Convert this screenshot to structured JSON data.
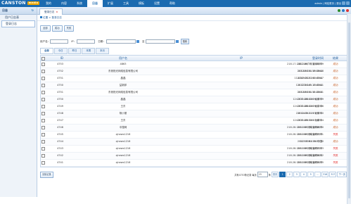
{
  "app": {
    "logo_text": "CANSTON",
    "logo_badge": "media",
    "top_nav": [
      "我的",
      "内容",
      "系统",
      "日志",
      "扩展",
      "工具",
      "模板",
      "设置",
      "帮助"
    ],
    "active_nav_index": 3,
    "user_info": "admin | 网站首页 | 退出"
  },
  "sidebar": {
    "title": "日志",
    "items": [
      {
        "label": "用户日志表",
        "selected": false
      },
      {
        "label": "登录日志",
        "selected": true
      }
    ]
  },
  "tab": {
    "label": "登录日志"
  },
  "breadcrumb": "位置 > 登录日志",
  "toolbar": {
    "buttons": [
      "全部",
      "成功",
      "失败"
    ]
  },
  "filter": {
    "user_label": "用户名：",
    "ip_label": "IP：",
    "date_label": "日期：",
    "to_label": "至",
    "search_label": "搜索"
  },
  "subtabs": [
    "全部",
    "今日",
    "昨日",
    "本周",
    "本月"
  ],
  "active_subtab": 0,
  "table": {
    "headers": {
      "id": "ID",
      "user": "用户名",
      "ip": "IP",
      "time": "登录时间",
      "result": "结果"
    },
    "rows": [
      {
        "id": "4753",
        "user": "4863",
        "ip": "218.17.148.216 广东省深圳市",
        "time": "2012-06-01 15:15:59",
        "result": "成功"
      },
      {
        "id": "4752",
        "user": "东莞阳光网络信息有限公司",
        "ip": "113.83.254.58 IANA",
        "time": "2012-06-01 15:15:08",
        "result": "成功"
      },
      {
        "id": "4751",
        "user": "晶晶",
        "ip": "114.249.212.160 IANA",
        "time": "2012-06-01 14:47:07",
        "result": "成功"
      },
      {
        "id": "4750",
        "user": "益新邦",
        "ip": "110.172.249.18 IANA",
        "time": "2012-06-01 13:47:01",
        "result": "成功"
      },
      {
        "id": "4751",
        "user": "东莞阳光网络信息有限公司",
        "ip": "113.83.254.58 IANA",
        "time": "2012-06-01 11:23:31",
        "result": "成功"
      },
      {
        "id": "4750",
        "user": "晶晶",
        "ip": "124.205.186.160 北京市",
        "time": "2012-06-01 09:28:59",
        "result": "成功"
      },
      {
        "id": "4749",
        "user": "王东",
        "ip": "124.205.186.160 北京市",
        "time": "2012-06-01 09:02:46",
        "result": "成功"
      },
      {
        "id": "4748",
        "user": "杨小丽",
        "ip": "210.14.142.19 北京市",
        "time": "2012-05-31 23:36:10",
        "result": "成功"
      },
      {
        "id": "4747",
        "user": "王东",
        "ip": "124.205.186.160 北京市",
        "time": "2012-05-31 17:48:24",
        "result": "成功"
      },
      {
        "id": "4746",
        "user": "中搜网",
        "ip": "218.28.115.130 河南省郑州市",
        "time": "2012-05-31 16:48:30",
        "result": "成功"
      },
      {
        "id": "4745",
        "user": "zjnews1216",
        "ip": "218.28.115.130 河南省郑州市",
        "time": "2012-05-31 16:37:31",
        "result": "失败"
      },
      {
        "id": "4744",
        "user": "zjnews1216",
        "ip": "117.136.0.34 中国",
        "time": "2012-05-31 16:37:30",
        "result": "成功"
      },
      {
        "id": "4743",
        "user": "zjnews1216",
        "ip": "218.28.115.130 河南省郑州市",
        "time": "2012-05-31 16:37:23",
        "result": "失败"
      },
      {
        "id": "4742",
        "user": "zjnews1216",
        "ip": "218.28.115.130 河南省郑州市",
        "time": "2012-05-31 16:36:12",
        "result": "失败"
      },
      {
        "id": "4741",
        "user": "zjnews1216",
        "ip": "218.28.115.130 河南省郑州市",
        "time": "2012-05-31 16:35:35",
        "result": "失败"
      }
    ]
  },
  "footer": {
    "clear_label": "清除记录",
    "total_text": "共有4753条记录",
    "per_page_label": "每页",
    "per_page_value": "15",
    "per_page_unit": "条",
    "pages": [
      "首页",
      "1",
      "2",
      "3",
      "4",
      "5",
      "...",
      "316",
      "317",
      "下一页"
    ],
    "current_page": "1"
  }
}
